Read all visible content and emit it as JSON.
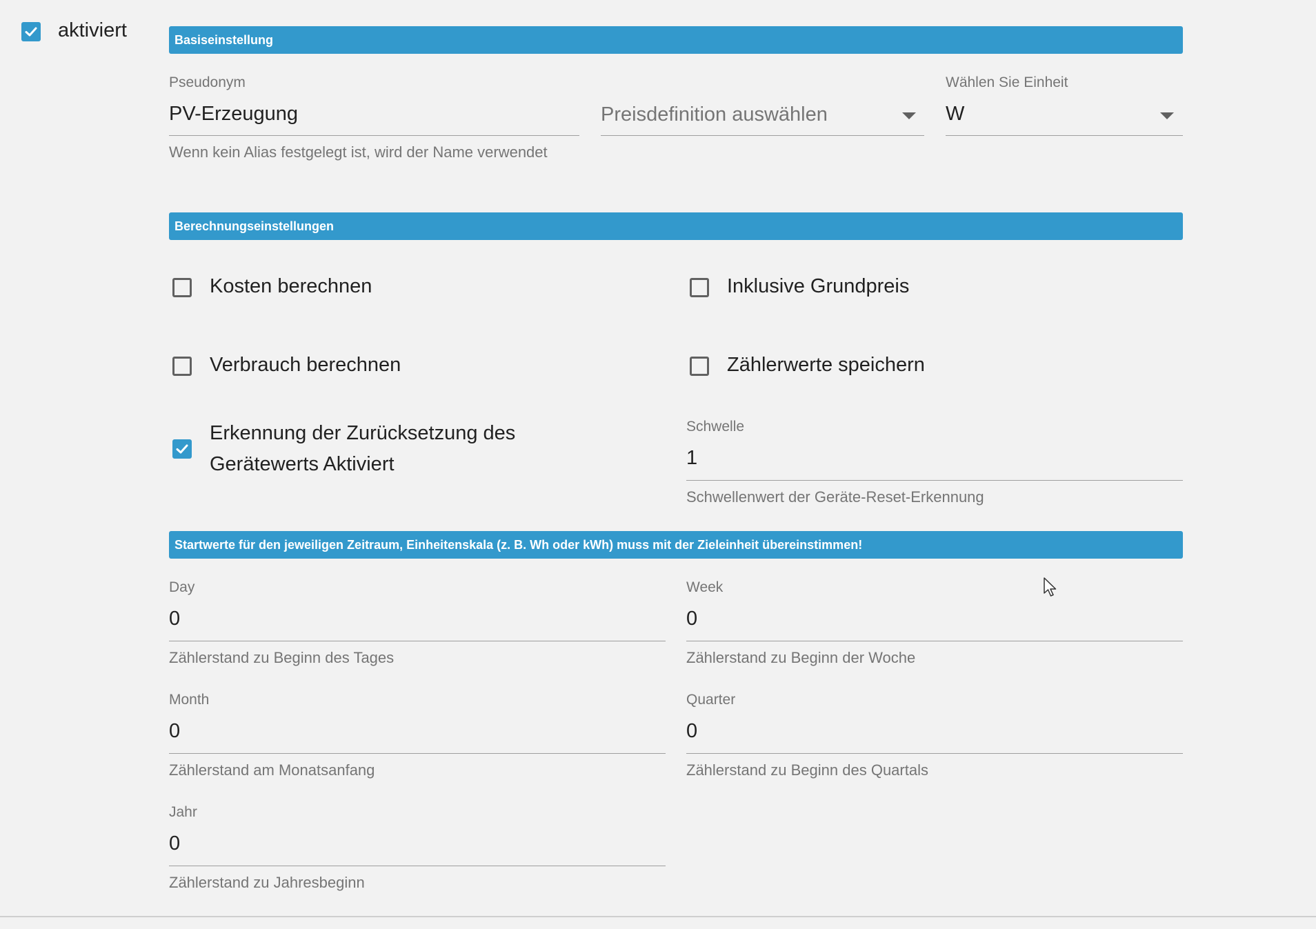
{
  "enabled": {
    "label": "aktiviert",
    "checked": true
  },
  "sections": {
    "basic": "Basiseinstellung",
    "calc": "Berechnungseinstellungen",
    "start": "Startwerte für den jeweiligen Zeitraum, Einheitenskala (z. B. Wh oder kWh) muss mit der Zieleinheit übereinstimmen!"
  },
  "basic": {
    "alias": {
      "label": "Pseudonym",
      "value": "PV-Erzeugung",
      "help": "Wenn kein Alias festgelegt ist, wird der Name verwendet"
    },
    "price": {
      "placeholder": "Preisdefinition auswählen"
    },
    "unit": {
      "label": "Wählen Sie Einheit",
      "value": "W"
    }
  },
  "calc": {
    "costs": {
      "label": "Kosten berechnen",
      "checked": false
    },
    "basePrice": {
      "label": "Inklusive Grundpreis",
      "checked": false
    },
    "consumption": {
      "label": "Verbrauch berechnen",
      "checked": false
    },
    "meterValues": {
      "label": "Zählerwerte speichern",
      "checked": false
    },
    "resetDetect": {
      "label_line1": "Erkennung der Zurücksetzung des",
      "label_line2": "Gerätewerts Aktiviert",
      "checked": true
    },
    "threshold": {
      "label": "Schwelle",
      "value": "1",
      "help": "Schwellenwert der Geräte-Reset-Erkennung"
    }
  },
  "start": {
    "day": {
      "label": "Day",
      "value": "0",
      "help": "Zählerstand zu Beginn des Tages"
    },
    "week": {
      "label": "Week",
      "value": "0",
      "help": "Zählerstand zu Beginn der Woche"
    },
    "month": {
      "label": "Month",
      "value": "0",
      "help": "Zählerstand am Monatsanfang"
    },
    "quarter": {
      "label": "Quarter",
      "value": "0",
      "help": "Zählerstand zu Beginn des Quartals"
    },
    "year": {
      "label": "Jahr",
      "value": "0",
      "help": "Zählerstand zu Jahresbeginn"
    }
  },
  "colors": {
    "accent": "#3399cc",
    "background": "#f2f2f2"
  }
}
